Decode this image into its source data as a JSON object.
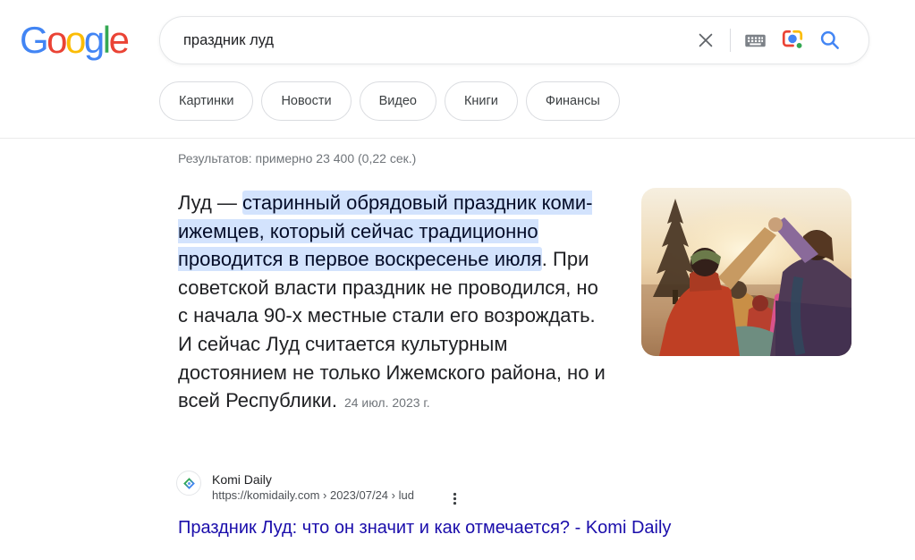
{
  "logo": {
    "letters": [
      {
        "ch": "G",
        "color": "#4285F4"
      },
      {
        "ch": "o",
        "color": "#EA4335"
      },
      {
        "ch": "o",
        "color": "#FBBC05"
      },
      {
        "ch": "g",
        "color": "#4285F4"
      },
      {
        "ch": "l",
        "color": "#34A853"
      },
      {
        "ch": "e",
        "color": "#EA4335"
      }
    ]
  },
  "search": {
    "query": "праздник луд"
  },
  "icons": {
    "clear": "clear-x",
    "keyboard": "virtual-keyboard",
    "lens": "google-lens-camera",
    "search": "magnifier",
    "more_options": "vertical-three-dots",
    "favicon": "komi-daily-diamond"
  },
  "tabs": [
    "Картинки",
    "Новости",
    "Видео",
    "Книги",
    "Финансы"
  ],
  "stats": "Результатов: примерно 23 400 (0,22 сек.)",
  "snippet": {
    "lead": "Луд — ",
    "highlight": "старинный обрядовый праздник коми-ижемцев, который сейчас традиционно проводится в первое воскресенье июля",
    "rest": ". При советской власти праздник не проводился, но с начала 90-х местные стали его возрождать. И сейчас Луд считается культурным достоянием не только Ижемского района, но и всей Республики.",
    "date": "24 июл. 2023 г."
  },
  "source": {
    "name": "Komi Daily",
    "url": "https://komidaily.com › 2023/07/24 › lud"
  },
  "result_title": "Праздник Луд: что он значит и как отмечается? - Komi Daily",
  "colors": {
    "link_blue": "#1a0dab",
    "highlight_bg": "#d3e3fd",
    "highlight_text": "#040c28",
    "accent_blue": "#4285f4",
    "logo_blue": "#4285F4",
    "logo_red": "#EA4335",
    "logo_yellow": "#FBBC05",
    "logo_green": "#34A853",
    "chip_border": "#dadce0",
    "stats_gray": "#70757a"
  }
}
